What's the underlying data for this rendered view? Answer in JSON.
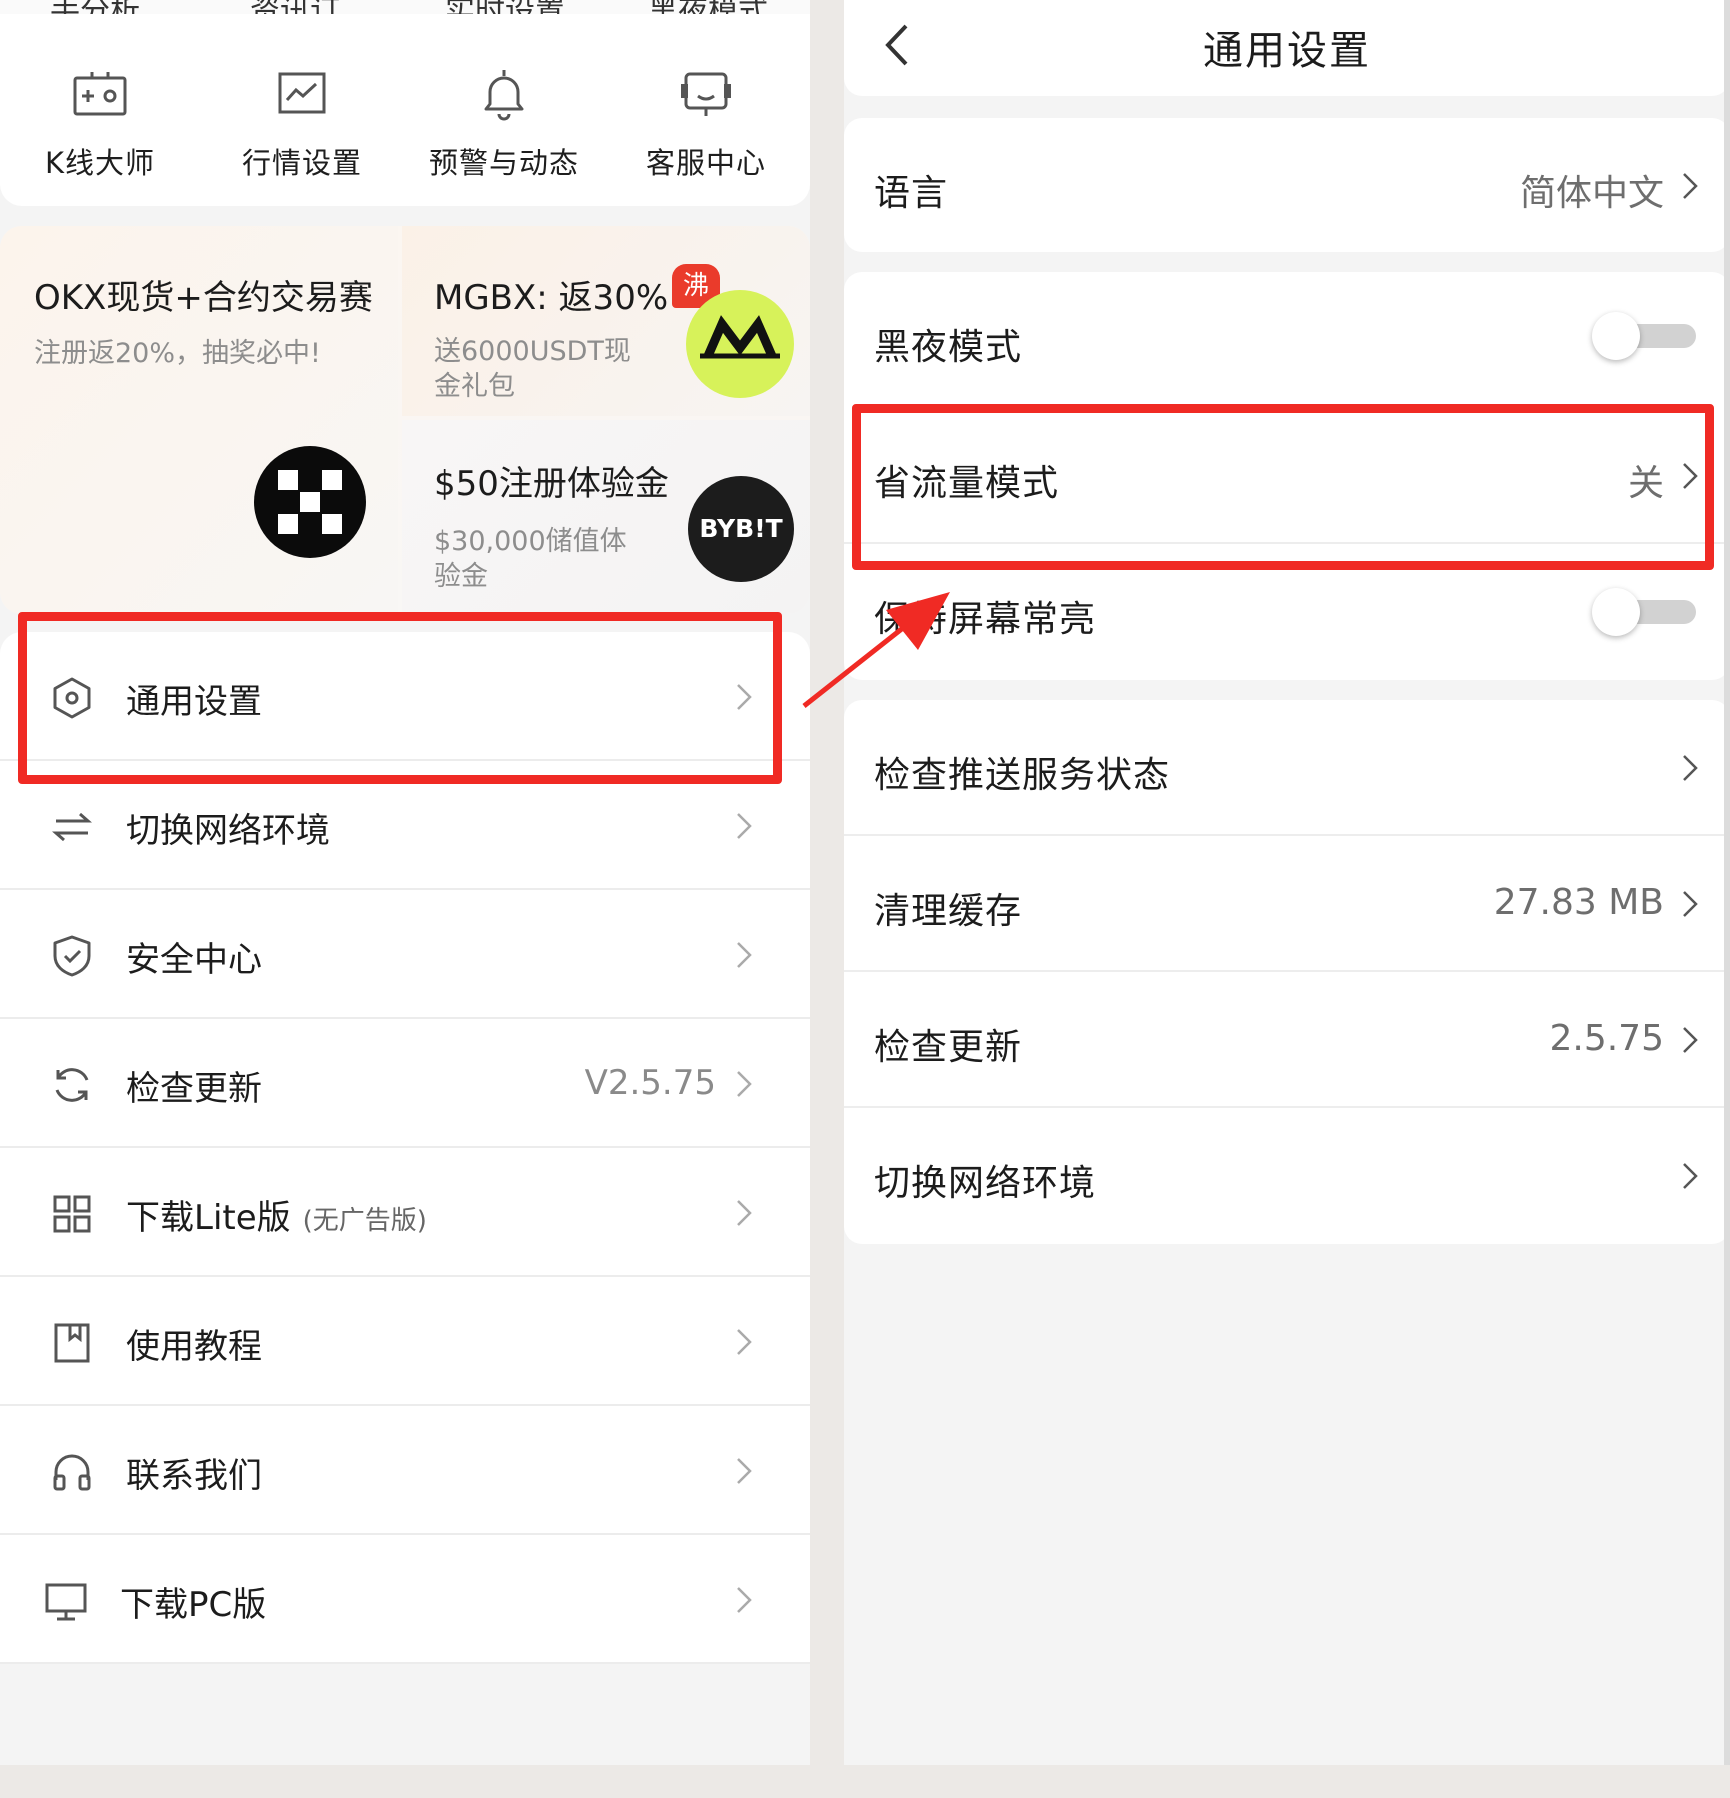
{
  "left": {
    "top_cut_labels": [
      "手分析",
      "资讯订",
      "实时设置",
      "黑夜模式"
    ],
    "quick_actions": [
      {
        "label": "K线大师",
        "icon": "kline-icon"
      },
      {
        "label": "行情设置",
        "icon": "chart-icon"
      },
      {
        "label": "预警与动态",
        "icon": "bell-icon"
      },
      {
        "label": "客服中心",
        "icon": "support-icon"
      }
    ],
    "promos": [
      {
        "title": "OKX现货+合约交易赛",
        "subtitle": "注册返20%，抽奖必中!",
        "logo": "okx-logo"
      },
      {
        "title": "MGBX: 返30%",
        "badge": "沸",
        "subtitle_line1": "送6000USDT现",
        "subtitle_line2": "金礼包",
        "logo": "mgbx-logo"
      },
      {
        "title": "$50注册体验金",
        "subtitle_line1": "$30,000储值体",
        "subtitle_line2": "验金",
        "logo_text": "BYB!T"
      }
    ],
    "menu": [
      {
        "label": "通用设置",
        "icon": "settings-icon",
        "value": ""
      },
      {
        "label": "切换网络环境",
        "icon": "swap-icon",
        "value": ""
      },
      {
        "label": "安全中心",
        "icon": "shield-icon",
        "value": ""
      },
      {
        "label": "检查更新",
        "icon": "refresh-icon",
        "value": "V2.5.75"
      },
      {
        "label": "下载Lite版",
        "sub": "(无广告版)",
        "icon": "grid-icon",
        "value": ""
      },
      {
        "label": "使用教程",
        "icon": "book-icon",
        "value": ""
      },
      {
        "label": "联系我们",
        "icon": "headset-icon",
        "value": ""
      },
      {
        "label": "下载PC版",
        "icon": "monitor-icon",
        "value": ""
      }
    ]
  },
  "right": {
    "title": "通用设置",
    "rows": {
      "language": {
        "label": "语言",
        "value": "简体中文"
      },
      "dark_mode": {
        "label": "黑夜模式",
        "on": false
      },
      "data_saver": {
        "label": "省流量模式",
        "value": "关"
      },
      "keep_screen_on": {
        "label": "保持屏幕常亮",
        "on": false
      },
      "push_status": {
        "label": "检查推送服务状态"
      },
      "clear_cache": {
        "label": "清理缓存",
        "value": "27.83 MB"
      },
      "check_update": {
        "label": "检查更新",
        "value": "2.5.75"
      },
      "switch_network": {
        "label": "切换网络环境"
      }
    }
  },
  "colors": {
    "annotation_red": "#f02a24",
    "mgbx_green": "#d7f25a",
    "hot_badge": "#ea3b2b"
  }
}
